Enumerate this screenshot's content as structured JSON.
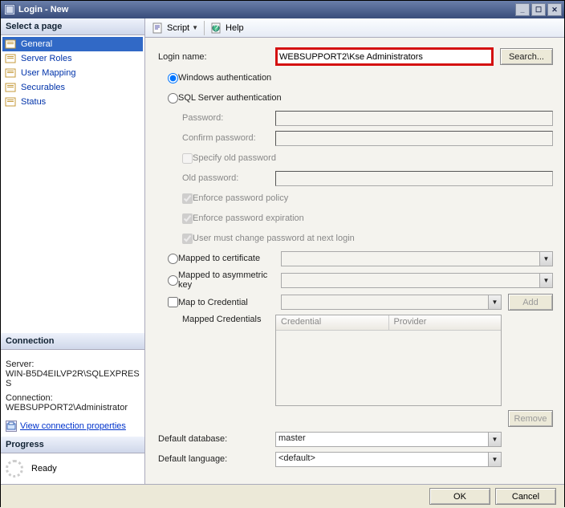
{
  "window": {
    "title": "Login - New"
  },
  "sidebar": {
    "select_page": "Select a page",
    "items": [
      {
        "label": "General",
        "selected": true
      },
      {
        "label": "Server Roles"
      },
      {
        "label": "User Mapping"
      },
      {
        "label": "Securables"
      },
      {
        "label": "Status"
      }
    ],
    "connection": {
      "header": "Connection",
      "server_label": "Server:",
      "server": "WIN-B5D4EILVP2R\\SQLEXPRESS",
      "connection_label": "Connection:",
      "connection": "WEBSUPPORT2\\Administrator",
      "view_link": "View connection properties"
    },
    "progress": {
      "header": "Progress",
      "text": "Ready"
    }
  },
  "toolbar": {
    "script": "Script",
    "help": "Help"
  },
  "form": {
    "login_name_label": "Login name:",
    "login_name": "WEBSUPPORT2\\Kse Administrators",
    "search": "Search...",
    "windows_auth": "Windows authentication",
    "sql_auth": "SQL Server authentication",
    "password_label": "Password:",
    "confirm_password_label": "Confirm password:",
    "specify_old_password": "Specify old password",
    "old_password_label": "Old password:",
    "enforce_policy": "Enforce password policy",
    "enforce_expiration": "Enforce password expiration",
    "must_change": "User must change password at next login",
    "mapped_cert": "Mapped to certificate",
    "mapped_asym": "Mapped to asymmetric key",
    "map_cred": "Map to Credential",
    "mapped_credentials": "Mapped Credentials",
    "add": "Add",
    "remove": "Remove",
    "th_credential": "Credential",
    "th_provider": "Provider",
    "default_db_label": "Default database:",
    "default_db": "master",
    "default_lang_label": "Default language:",
    "default_lang": "<default>"
  },
  "buttons": {
    "ok": "OK",
    "cancel": "Cancel"
  }
}
